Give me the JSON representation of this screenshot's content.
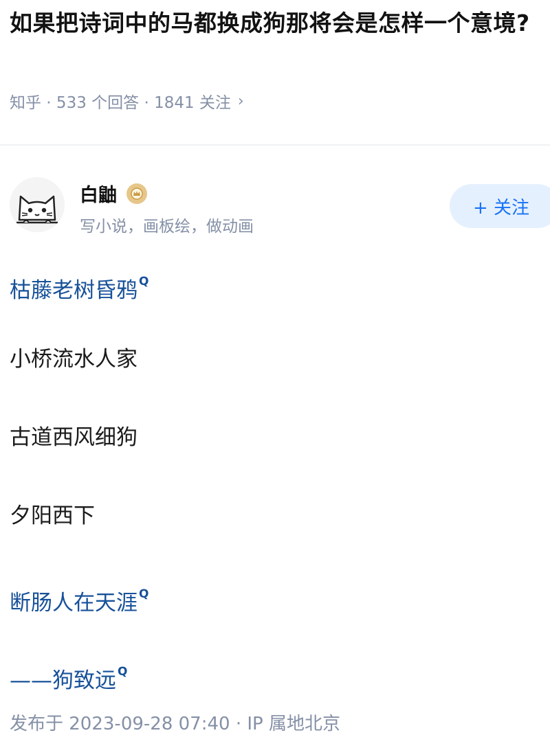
{
  "question": {
    "title": "如果把诗词中的马都换成狗那将会是怎样一个意境?",
    "meta": "知乎 · 533 个回答 · 1841 关注",
    "chevron": "›"
  },
  "author": {
    "name": "白鼬",
    "bio": "写小说，画板绘，做动画",
    "avatar_icon": "cat-face-icon",
    "badge_icon": "crown-badge-icon",
    "follow_label": "+ 关注"
  },
  "answer": {
    "lines": [
      {
        "text": "枯藤老树昏鸦",
        "linked": true
      },
      {
        "text": "小桥流水人家",
        "linked": false
      },
      {
        "text": "古道西风细狗",
        "linked": false
      },
      {
        "text": "夕阳西下",
        "linked": false
      },
      {
        "text": "断肠人在天涯",
        "linked": true
      },
      {
        "text": "——狗致远",
        "linked": true
      }
    ],
    "search_mark": "Q",
    "published": "发布于 2023-09-28 07:40 · IP 属地北京"
  },
  "colors": {
    "link": "#175199",
    "meta": "#8590a6",
    "follow_bg": "#e5f0ff",
    "follow_text": "#1772f6",
    "badge": "#e7c68a"
  }
}
